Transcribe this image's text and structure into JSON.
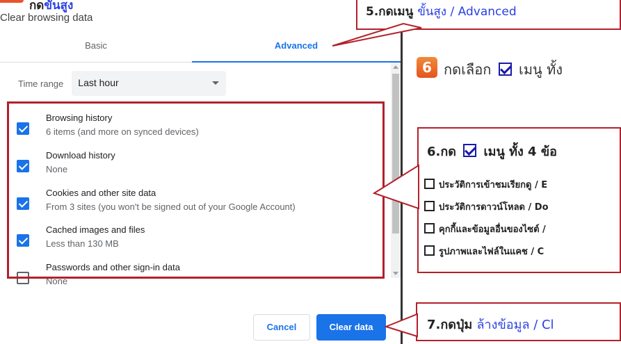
{
  "dialog": {
    "title": "Clear browsing data",
    "tabs": [
      {
        "label": "Basic",
        "active": false
      },
      {
        "label": "Advanced",
        "active": true
      }
    ],
    "time_range": {
      "label": "Time range",
      "value": "Last hour"
    },
    "items": [
      {
        "title": "Browsing history",
        "subtitle": "6 items (and more on synced devices)",
        "checked": true
      },
      {
        "title": "Download history",
        "subtitle": "None",
        "checked": true
      },
      {
        "title": "Cookies and other site data",
        "subtitle": "From 3 sites (you won't be signed out of your Google Account)",
        "checked": true
      },
      {
        "title": "Cached images and files",
        "subtitle": "Less than 130 MB",
        "checked": true
      },
      {
        "title": "Passwords and other sign-in data",
        "subtitle": "None",
        "checked": false
      }
    ],
    "buttons": {
      "cancel": "Cancel",
      "clear": "Clear data"
    },
    "accent_color": "#1a73e8"
  },
  "annotations": {
    "top_cut": {
      "prefix": "กด",
      "blue": "ขั้นสูง"
    },
    "step5": {
      "prefix": "5.กดเมนู",
      "blue": "ขั้นสูง / Advanced"
    },
    "step6_badge": "6",
    "step6_intro": {
      "prefix": "กดเลือก",
      "suffix": "เมนู ทั้ง"
    },
    "step6_box": {
      "title_prefix": "6.กด",
      "title_suffix": "เมนู ทั้ง 4 ข้อ",
      "lines": [
        "ประวัติการเข้าชมเรียกดู / E",
        "ประวัติการดาวน์โหลด / Do",
        "คุกกี้และข้อมูลอื่นของไซต์ /",
        "รูปภาพและไฟล์ในแคช / C"
      ]
    },
    "step7": {
      "prefix": "7.กดปุ่ม",
      "blue": "ล้างข้อมูล / Cl"
    },
    "highlight_color": "#b3202a"
  }
}
